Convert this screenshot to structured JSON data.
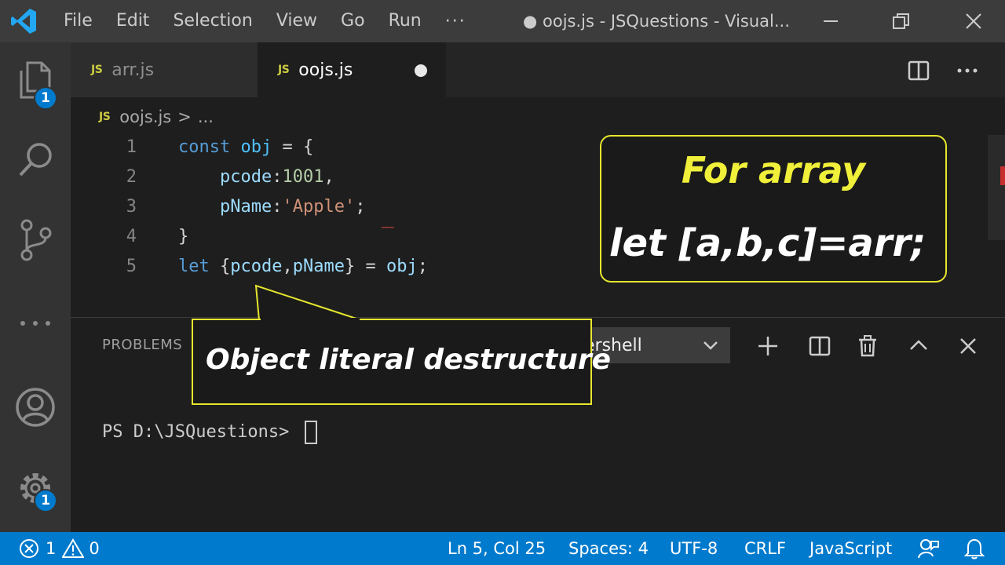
{
  "titlebar": {
    "menu": [
      "File",
      "Edit",
      "Selection",
      "View",
      "Go",
      "Run"
    ],
    "menu_more": "···",
    "window_title": "● oojs.js - JSQuestions - Visual..."
  },
  "activity": {
    "explorer_badge": "1",
    "settings_badge": "1"
  },
  "tabs": [
    {
      "icon": "JS",
      "label": "arr.js"
    },
    {
      "icon": "JS",
      "label": "oojs.js"
    }
  ],
  "breadcrumb": {
    "icon": "JS",
    "file": "oojs.js",
    "sep": ">",
    "rest": "..."
  },
  "editor": {
    "line_numbers": [
      "1",
      "2",
      "3",
      "4",
      "5"
    ],
    "lines": [
      [
        {
          "t": "const",
          "c": "kw"
        },
        {
          "t": " ",
          "c": "punc"
        },
        {
          "t": "obj",
          "c": "var"
        },
        {
          "t": " = {",
          "c": "punc"
        }
      ],
      [
        {
          "t": "    ",
          "c": "punc"
        },
        {
          "t": "pcode",
          "c": "prop"
        },
        {
          "t": ":",
          "c": "punc"
        },
        {
          "t": "1001",
          "c": "num"
        },
        {
          "t": ",",
          "c": "punc"
        }
      ],
      [
        {
          "t": "    ",
          "c": "punc"
        },
        {
          "t": "pName",
          "c": "prop"
        },
        {
          "t": ":",
          "c": "punc"
        },
        {
          "t": "'Apple'",
          "c": "str"
        },
        {
          "t": ";",
          "c": "punc"
        }
      ],
      [
        {
          "t": "}",
          "c": "punc"
        }
      ],
      [
        {
          "t": "let",
          "c": "kw"
        },
        {
          "t": " {",
          "c": "punc"
        },
        {
          "t": "pcode",
          "c": "prop"
        },
        {
          "t": ",",
          "c": "punc"
        },
        {
          "t": "pName",
          "c": "prop"
        },
        {
          "t": "} = ",
          "c": "punc"
        },
        {
          "t": "obj",
          "c": "prop"
        },
        {
          "t": ";",
          "c": "punc"
        }
      ]
    ]
  },
  "panel": {
    "tab_problems": "PROBLEMS",
    "terminal_select": "ershell",
    "prompt": "PS D:\\JSQuestions> "
  },
  "statusbar": {
    "errors": "1",
    "warnings": "0",
    "position": "Ln 5, Col 25",
    "spaces": "Spaces: 4",
    "encoding": "UTF-8",
    "eol": "CRLF",
    "language": "JavaScript"
  },
  "overlay": {
    "array_title": "For array",
    "array_code": "let [a,b,c]=arr;",
    "object_note": "Object literal destructure"
  },
  "colors": {
    "accent": "#007acc",
    "callout_border": "#e6e62e",
    "callout_title": "#f0f03a"
  }
}
